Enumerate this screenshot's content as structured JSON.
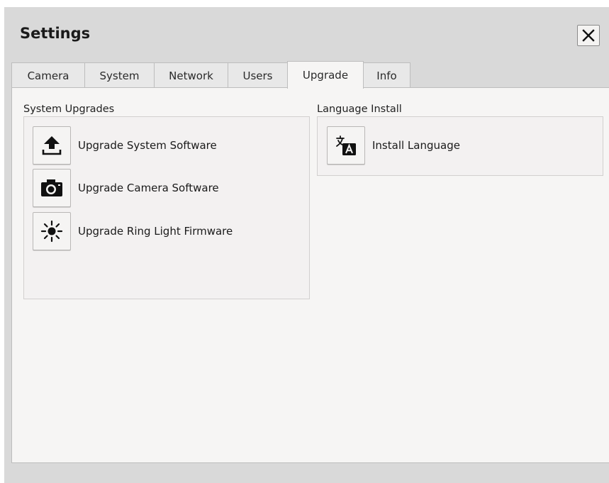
{
  "dialog": {
    "title": "Settings",
    "close_icon": "close-icon"
  },
  "tabs": [
    {
      "label": "Camera",
      "active": false
    },
    {
      "label": "System",
      "active": false
    },
    {
      "label": "Network",
      "active": false
    },
    {
      "label": "Users",
      "active": false
    },
    {
      "label": "Upgrade",
      "active": true
    },
    {
      "label": "Info",
      "active": false
    }
  ],
  "system_upgrades": {
    "label": "System Upgrades",
    "items": [
      {
        "label": "Upgrade System Software",
        "icon": "upload-icon"
      },
      {
        "label": "Upgrade Camera Software",
        "icon": "camera-icon"
      },
      {
        "label": "Upgrade Ring Light Firmware",
        "icon": "ring-light-icon"
      }
    ]
  },
  "language_install": {
    "label": "Language Install",
    "items": [
      {
        "label": "Install Language",
        "icon": "language-icon"
      }
    ]
  }
}
